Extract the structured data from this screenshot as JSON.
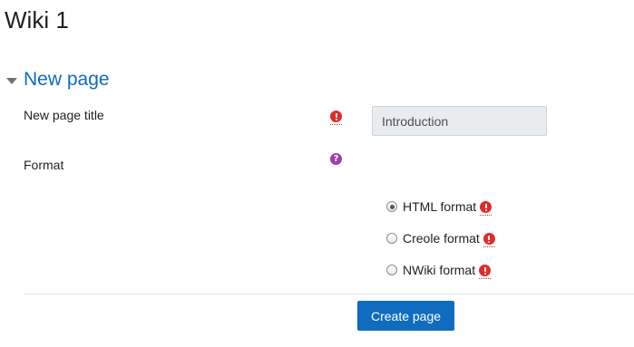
{
  "page": {
    "title": "Wiki 1"
  },
  "section": {
    "title": "New page",
    "expanded": true
  },
  "fields": {
    "page_title": {
      "label": "New page title",
      "value": "Introduction",
      "required_icon": "exclamation-circle-icon"
    },
    "format": {
      "label": "Format",
      "help_icon": "question-circle-icon",
      "help_glyph": "?",
      "selected": "HTML format",
      "options": [
        {
          "label": "HTML format",
          "checked": true,
          "icon": "exclamation-circle-icon"
        },
        {
          "label": "Creole format",
          "checked": false,
          "icon": "exclamation-circle-icon"
        },
        {
          "label": "NWiki format",
          "checked": false,
          "icon": "exclamation-circle-icon"
        }
      ]
    }
  },
  "actions": {
    "create_label": "Create page"
  },
  "colors": {
    "link_blue": "#0f6cbf",
    "required_red": "#e12b2b",
    "help_purple": "#9b3fb0",
    "input_bg": "#e9ecef"
  }
}
